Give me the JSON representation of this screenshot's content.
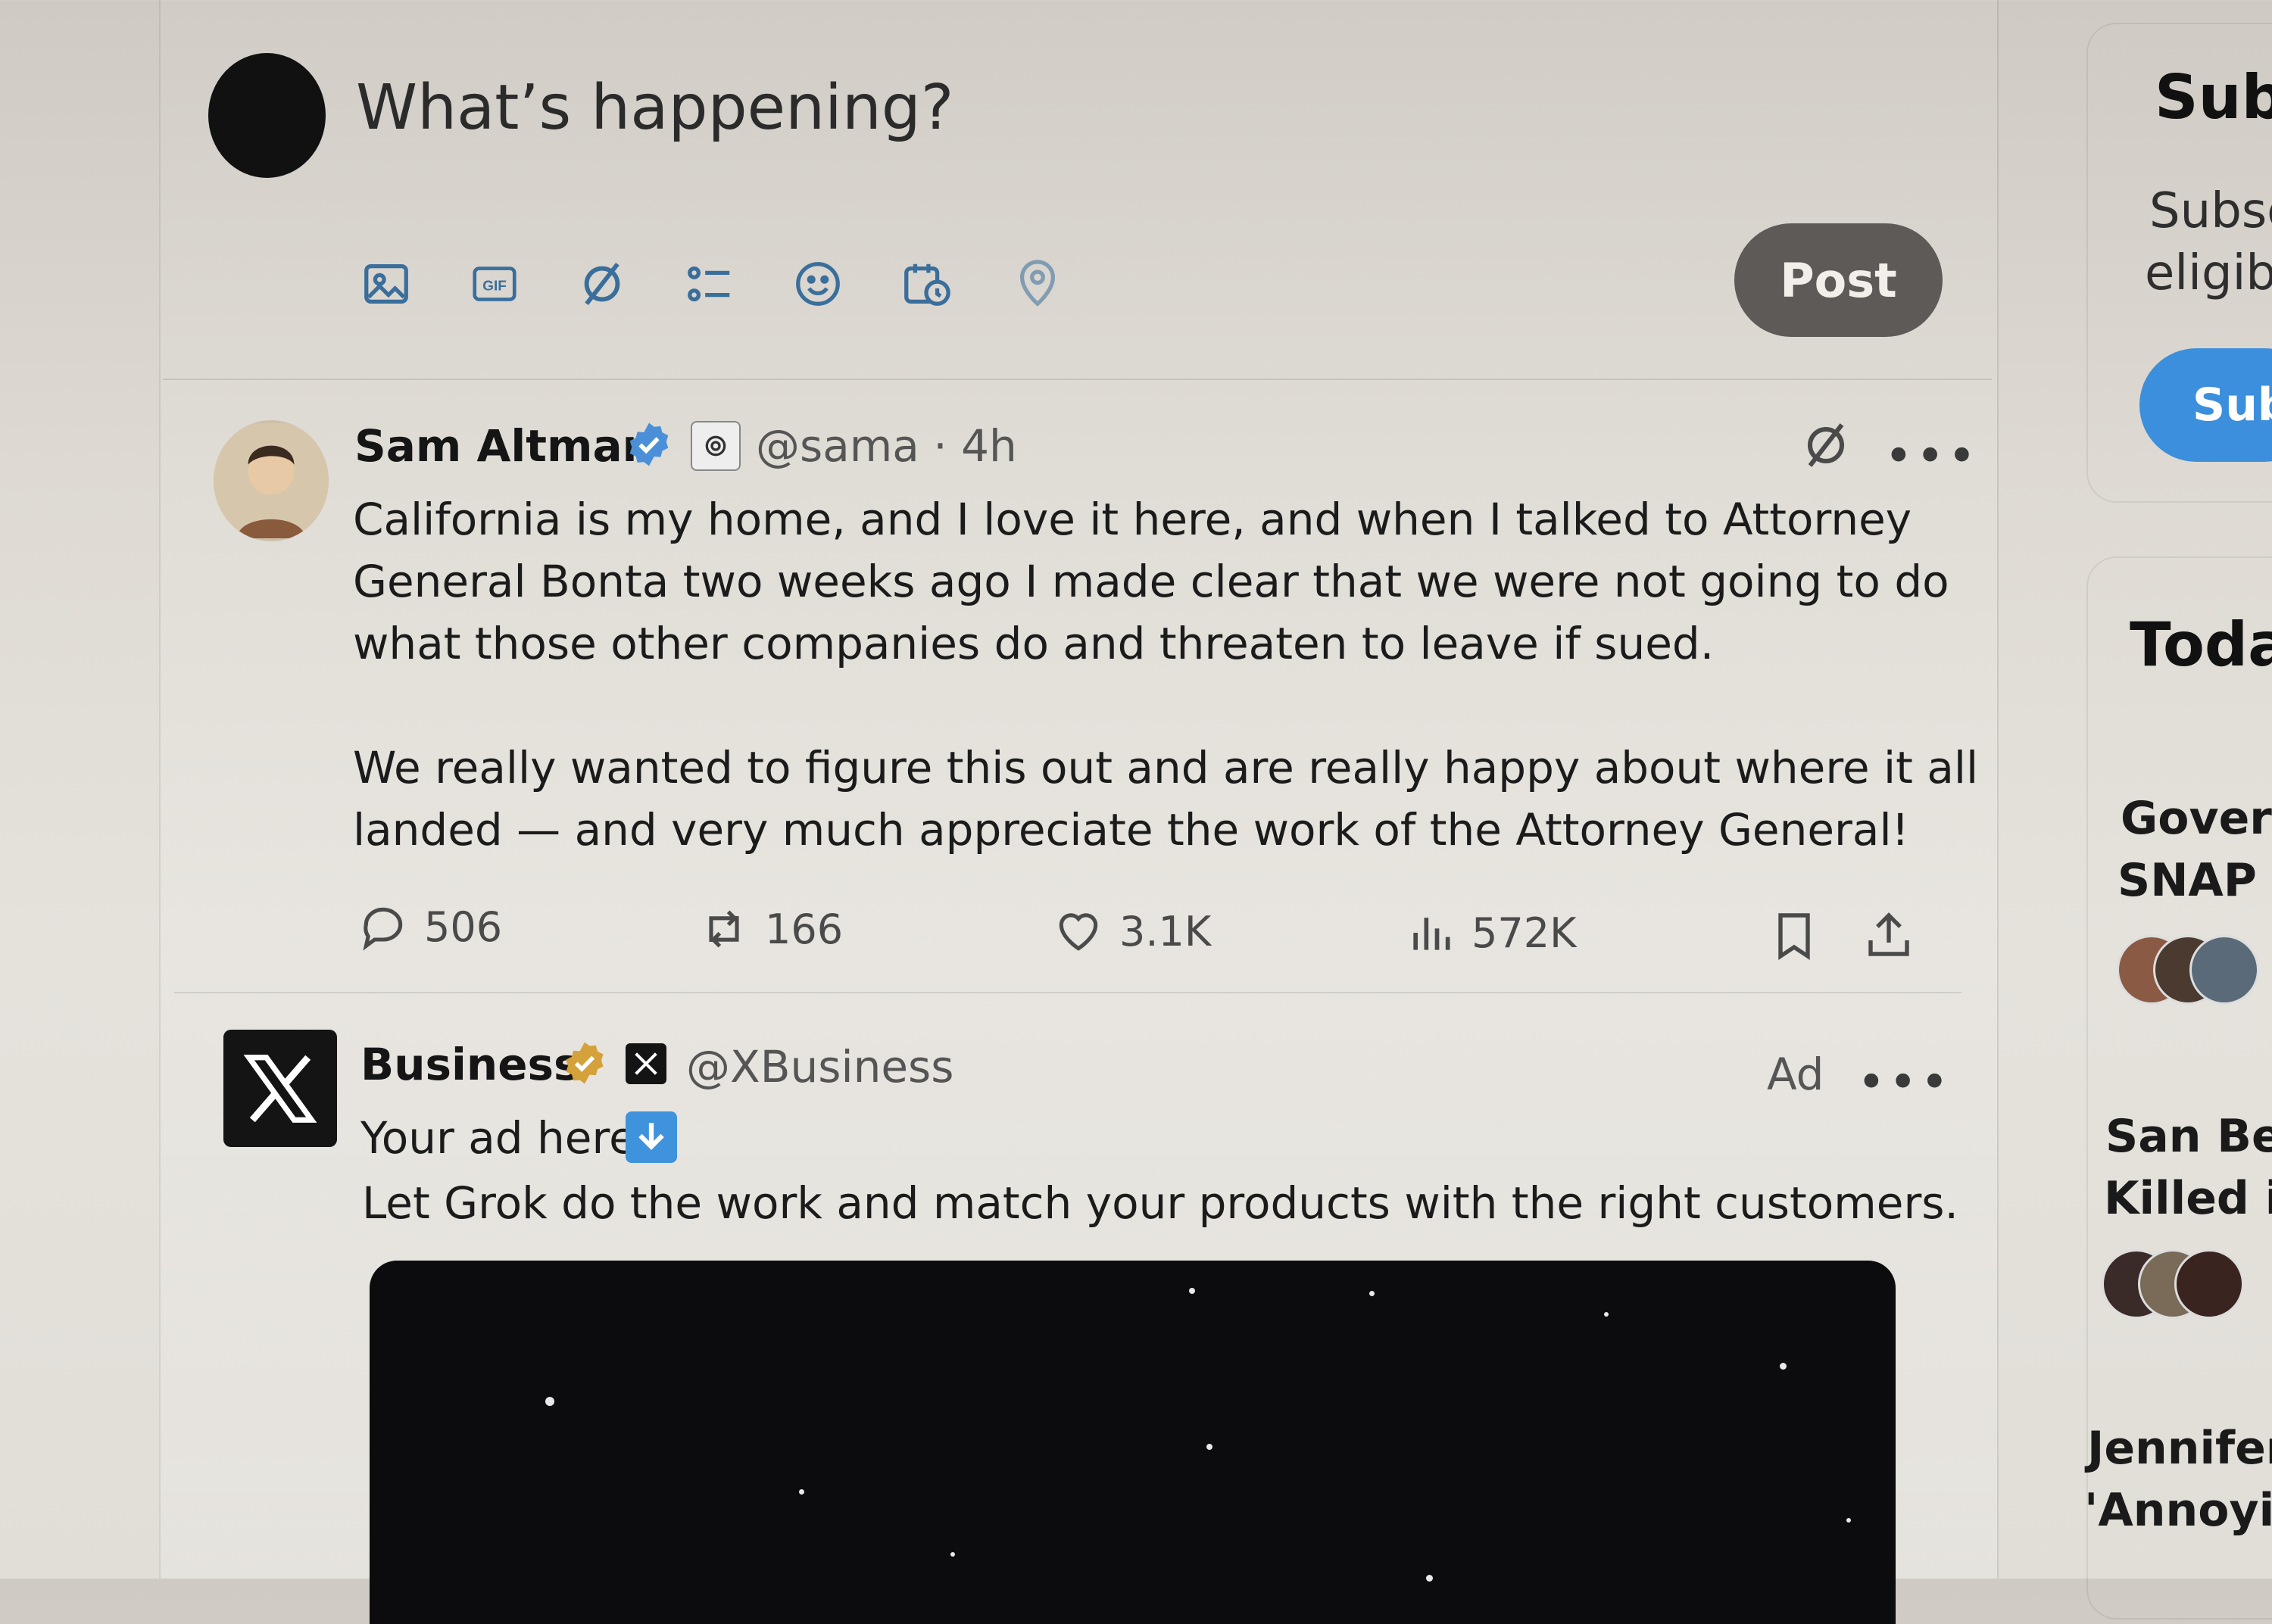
{
  "composer": {
    "placeholder": "What’s happening?",
    "tools": [
      "image-icon",
      "gif-icon",
      "grok-icon",
      "poll-icon",
      "emoji-icon",
      "schedule-icon",
      "location-icon"
    ],
    "post_label": "Post"
  },
  "tweet": {
    "author": "Sam Altman",
    "handle": "@sama · 4h",
    "lines": [
      "California is my home, and I love it here, and when I talked to Attorney",
      "General Bonta two weeks ago I made clear that we were not going to do",
      "what those other companies do and threaten to leave if sued.",
      "We really wanted to figure this out and are really happy about where it all",
      "landed — and very much appreciate the work of the Attorney General!"
    ],
    "replies": "506",
    "reposts": "166",
    "likes": "3.1K",
    "views": "572K"
  },
  "ad": {
    "author": "Business",
    "handle": "@XBusiness",
    "ad_label": "Ad",
    "line1": "Your ad here",
    "line2": "Let Grok do the work and match your products with the right customers."
  },
  "sidebar": {
    "subscribe_title": "Sub",
    "subscribe_text_1": "Subsc",
    "subscribe_text_2": "eligibl",
    "subscribe_button": "Sub",
    "today_title": "Toda",
    "news": [
      {
        "line1": "Goverr",
        "line2": "SNAP E"
      },
      {
        "line1": "San Ber",
        "line2": "Killed ir"
      },
      {
        "line1": "Jennifer",
        "line2": "'Annoyin"
      }
    ]
  },
  "colors": {
    "accent": "#1d9bf0",
    "post_button": "#5e5a58",
    "verified": "#4a8fd8",
    "gold": "#d4a13a"
  }
}
